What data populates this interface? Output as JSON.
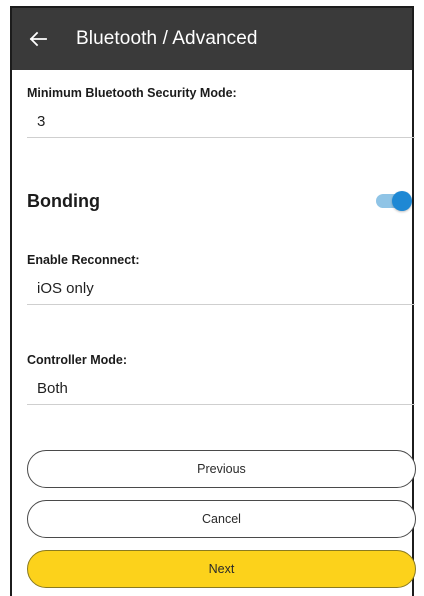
{
  "appbar": {
    "title": "Bluetooth / Advanced",
    "back_icon": "arrow-left-icon",
    "background": "#3a3a3a"
  },
  "security_mode": {
    "label": "Minimum Bluetooth Security Mode:",
    "value": "3"
  },
  "bonding": {
    "label": "Bonding",
    "enabled": true,
    "toggle_color": "#1e88d4"
  },
  "reconnect": {
    "label": "Enable Reconnect:",
    "value": "iOS only"
  },
  "controller_mode": {
    "label": "Controller Mode:",
    "value": "Both"
  },
  "buttons": {
    "previous": "Previous",
    "cancel": "Cancel",
    "next": "Next",
    "next_color": "#fcd21b"
  }
}
